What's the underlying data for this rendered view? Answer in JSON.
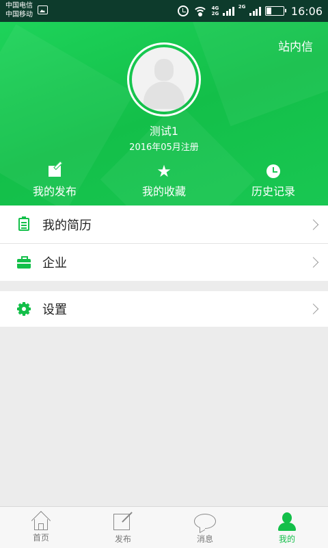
{
  "status_bar": {
    "carrier1": "中国电信",
    "carrier2": "中国移动",
    "net1": "4G",
    "net2": "2G",
    "net3": "2G",
    "time": "16:06"
  },
  "header": {
    "inbox_label": "站内信",
    "username": "测试1",
    "registered": "2016年05月注册",
    "actions": [
      {
        "label": "我的发布",
        "icon": "edit-icon"
      },
      {
        "label": "我的收藏",
        "icon": "star-icon"
      },
      {
        "label": "历史记录",
        "icon": "clock-icon"
      }
    ]
  },
  "menu": {
    "group1": [
      {
        "label": "我的简历",
        "icon": "resume-icon"
      },
      {
        "label": "企业",
        "icon": "briefcase-icon"
      }
    ],
    "group2": [
      {
        "label": "设置",
        "icon": "gear-icon"
      }
    ]
  },
  "bottom_nav": {
    "tabs": [
      {
        "label": "首页",
        "icon": "home-icon"
      },
      {
        "label": "发布",
        "icon": "post-icon"
      },
      {
        "label": "消息",
        "icon": "message-icon"
      },
      {
        "label": "我的",
        "icon": "profile-icon",
        "active": true
      }
    ]
  },
  "colors": {
    "accent": "#13bf49",
    "header_green": "#19c752",
    "background": "#ececec"
  },
  "star_glyph": "★"
}
